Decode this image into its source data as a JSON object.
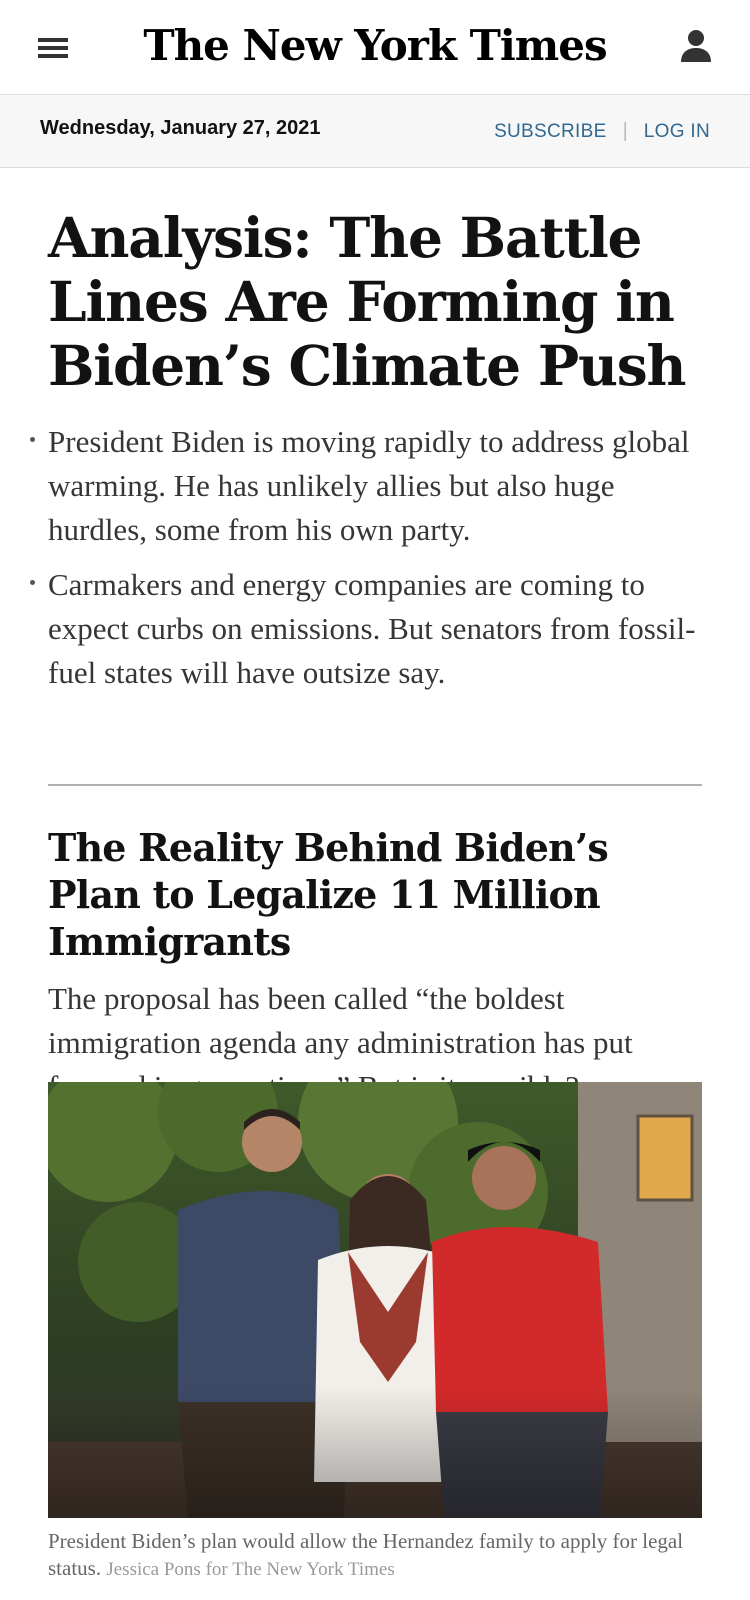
{
  "masthead": {
    "logo": "The New York Times",
    "menu_icon": "hamburger-menu-icon",
    "user_icon": "user-account-icon"
  },
  "datebar": {
    "date": "Wednesday, January 27, 2021",
    "subscribe_label": "SUBSCRIBE",
    "separator": "|",
    "login_label": "LOG IN",
    "link_color": "#326891"
  },
  "story1": {
    "headline": "Analysis: The Battle Lines Are Forming in Biden’s Climate Push",
    "bullets": [
      "President Biden is moving rapidly to address global warming. He has unlikely allies but also huge hurdles, some from his own party.",
      "Carmakers and energy companies are coming to expect curbs on emissions. But senators from fossil-fuel states will have outsize say."
    ]
  },
  "story2": {
    "headline": "The Reality Behind Biden’s Plan to Legalize 11 Million Immigrants",
    "summary": "The proposal has been called “the boldest immigration agenda any administration has put forward in generations.” But is it possible?",
    "caption": "President Biden’s plan would allow the Hernandez family to apply for legal status.",
    "credit": "Jessica Pons for The New York Times"
  }
}
